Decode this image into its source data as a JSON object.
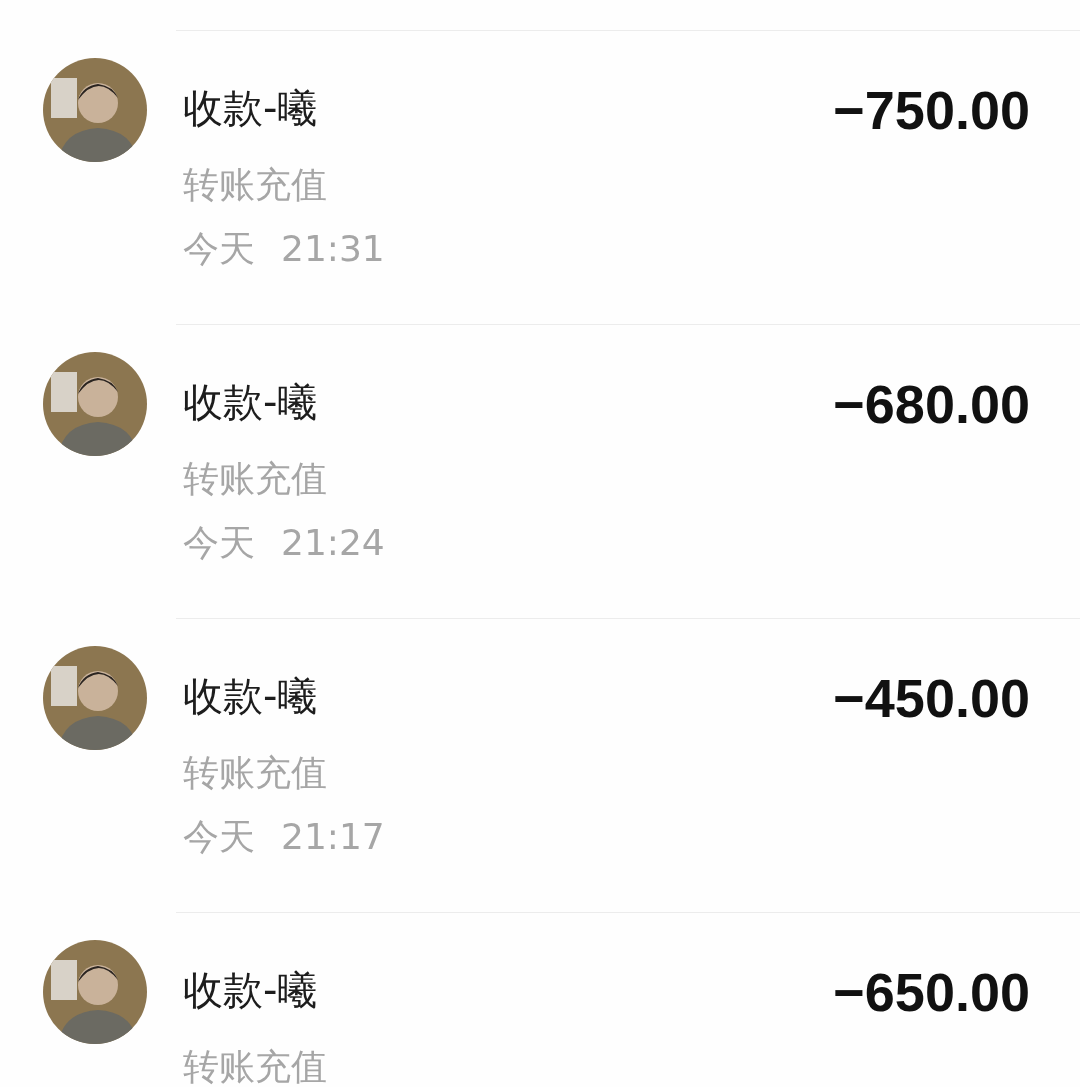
{
  "transactions": [
    {
      "title": "收款-曦",
      "amount": "−750.00",
      "category": "转账充值",
      "date": "今天",
      "time": "21:31"
    },
    {
      "title": "收款-曦",
      "amount": "−680.00",
      "category": "转账充值",
      "date": "今天",
      "time": "21:24"
    },
    {
      "title": "收款-曦",
      "amount": "−450.00",
      "category": "转账充值",
      "date": "今天",
      "time": "21:17"
    },
    {
      "title": "收款-曦",
      "amount": "−650.00",
      "category": "转账充值"
    }
  ]
}
